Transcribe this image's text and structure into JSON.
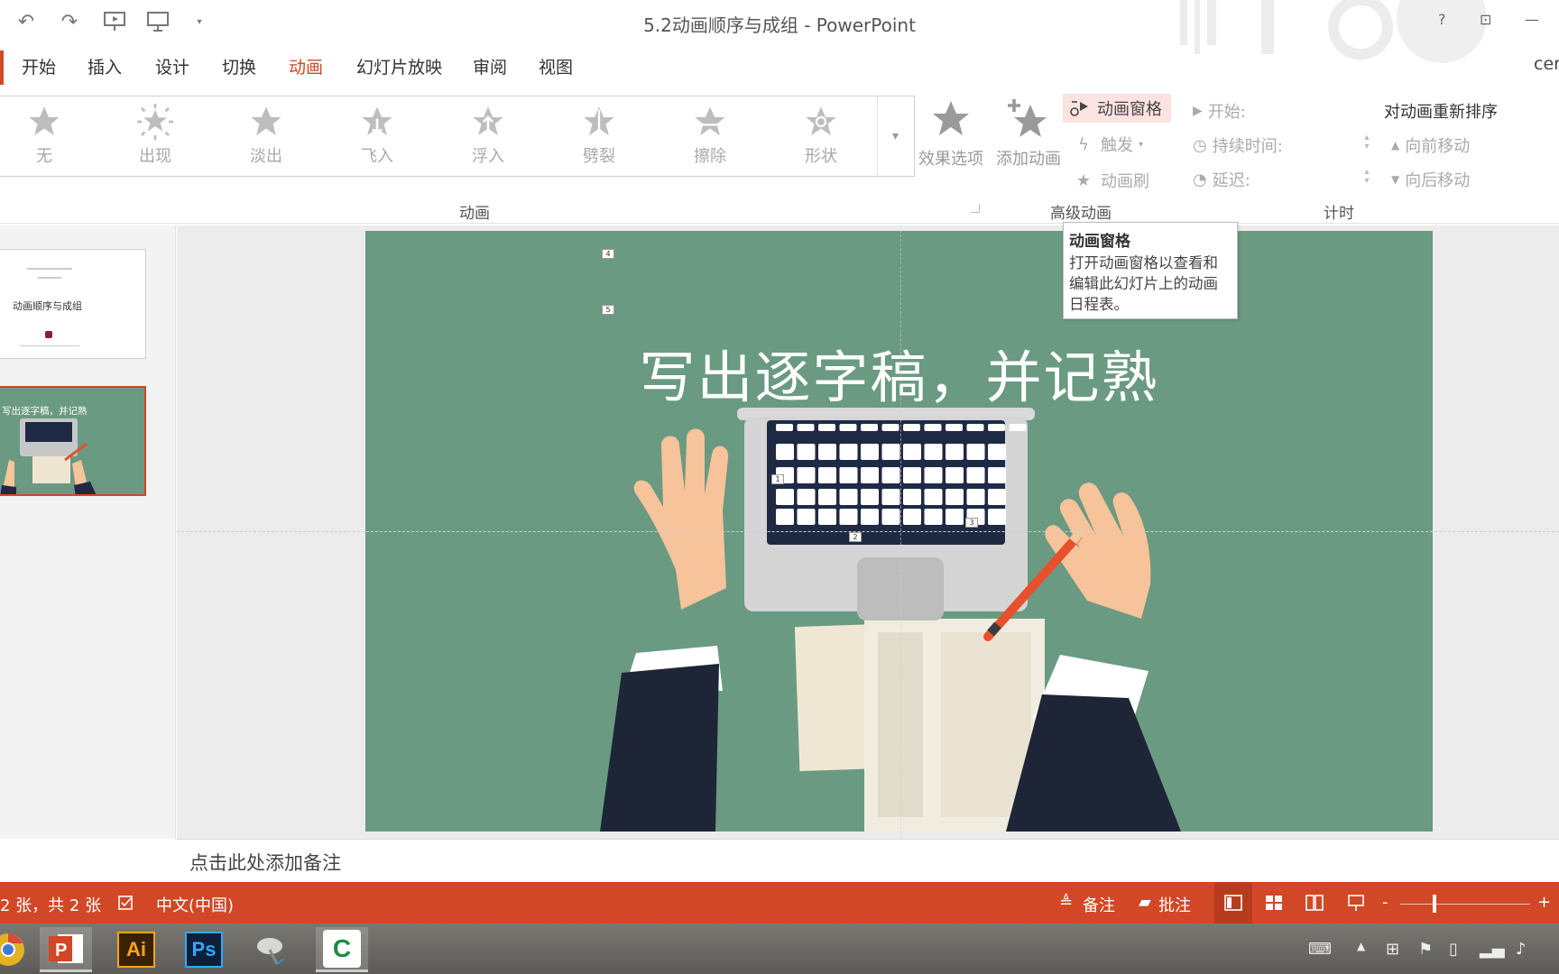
{
  "window": {
    "title": "5.2动画顺序与成组 - PowerPoint",
    "help": "?",
    "minimize": "—",
    "account_partial": "cer"
  },
  "tabs": [
    {
      "label": "开始",
      "active": false
    },
    {
      "label": "插入",
      "active": false
    },
    {
      "label": "设计",
      "active": false
    },
    {
      "label": "切换",
      "active": false
    },
    {
      "label": "动画",
      "active": true
    },
    {
      "label": "幻灯片放映",
      "active": false
    },
    {
      "label": "审阅",
      "active": false
    },
    {
      "label": "视图",
      "active": false
    }
  ],
  "animations": [
    {
      "label": "无",
      "icon": "star-icon"
    },
    {
      "label": "出现",
      "icon": "burst-star-icon"
    },
    {
      "label": "淡出",
      "icon": "star-icon"
    },
    {
      "label": "飞入",
      "icon": "fly-star-icon"
    },
    {
      "label": "浮入",
      "icon": "float-star-icon"
    },
    {
      "label": "劈裂",
      "icon": "split-star-icon"
    },
    {
      "label": "擦除",
      "icon": "wipe-star-icon"
    },
    {
      "label": "形状",
      "icon": "shape-star-icon"
    }
  ],
  "effect_options": "效果选项",
  "add_animation": "添加动画",
  "advanced": {
    "pane": "动画窗格",
    "trigger": "触发",
    "painter": "动画刷"
  },
  "timing": {
    "start": "开始:",
    "duration": "持续时间:",
    "delay": "延迟:",
    "reorder": "对动画重新排序",
    "move_earlier": "向前移动",
    "move_later": "向后移动"
  },
  "groups": {
    "animation": "动画",
    "advanced": "高级动画",
    "timing": "计时"
  },
  "tooltip": {
    "title": "动画窗格",
    "body": "打开动画窗格以查看和编辑此幻灯片上的动画日程表。"
  },
  "thumbnails": {
    "slide1_title": "动画顺序与成组",
    "slide2_title": "写出逐字稿，并记熟"
  },
  "slide": {
    "title": "写出逐字稿，并记熟",
    "tags": [
      "4",
      "5",
      "1",
      "2",
      "3"
    ]
  },
  "notes_placeholder": "点击此处添加备注",
  "status": {
    "slide_count": "2 张，共 2 张",
    "language": "中文(中国)",
    "notes": "备注",
    "comments": "批注",
    "zoom_minus": "-",
    "zoom_plus": "+"
  },
  "colors": {
    "accent": "#d24726",
    "slide_bg": "#6a9a82"
  },
  "taskbar": {
    "apps": [
      "chrome",
      "powerpoint",
      "illustrator",
      "photoshop",
      "satellite",
      "camtasia"
    ],
    "ai_label": "Ai",
    "ps_label": "Ps"
  }
}
